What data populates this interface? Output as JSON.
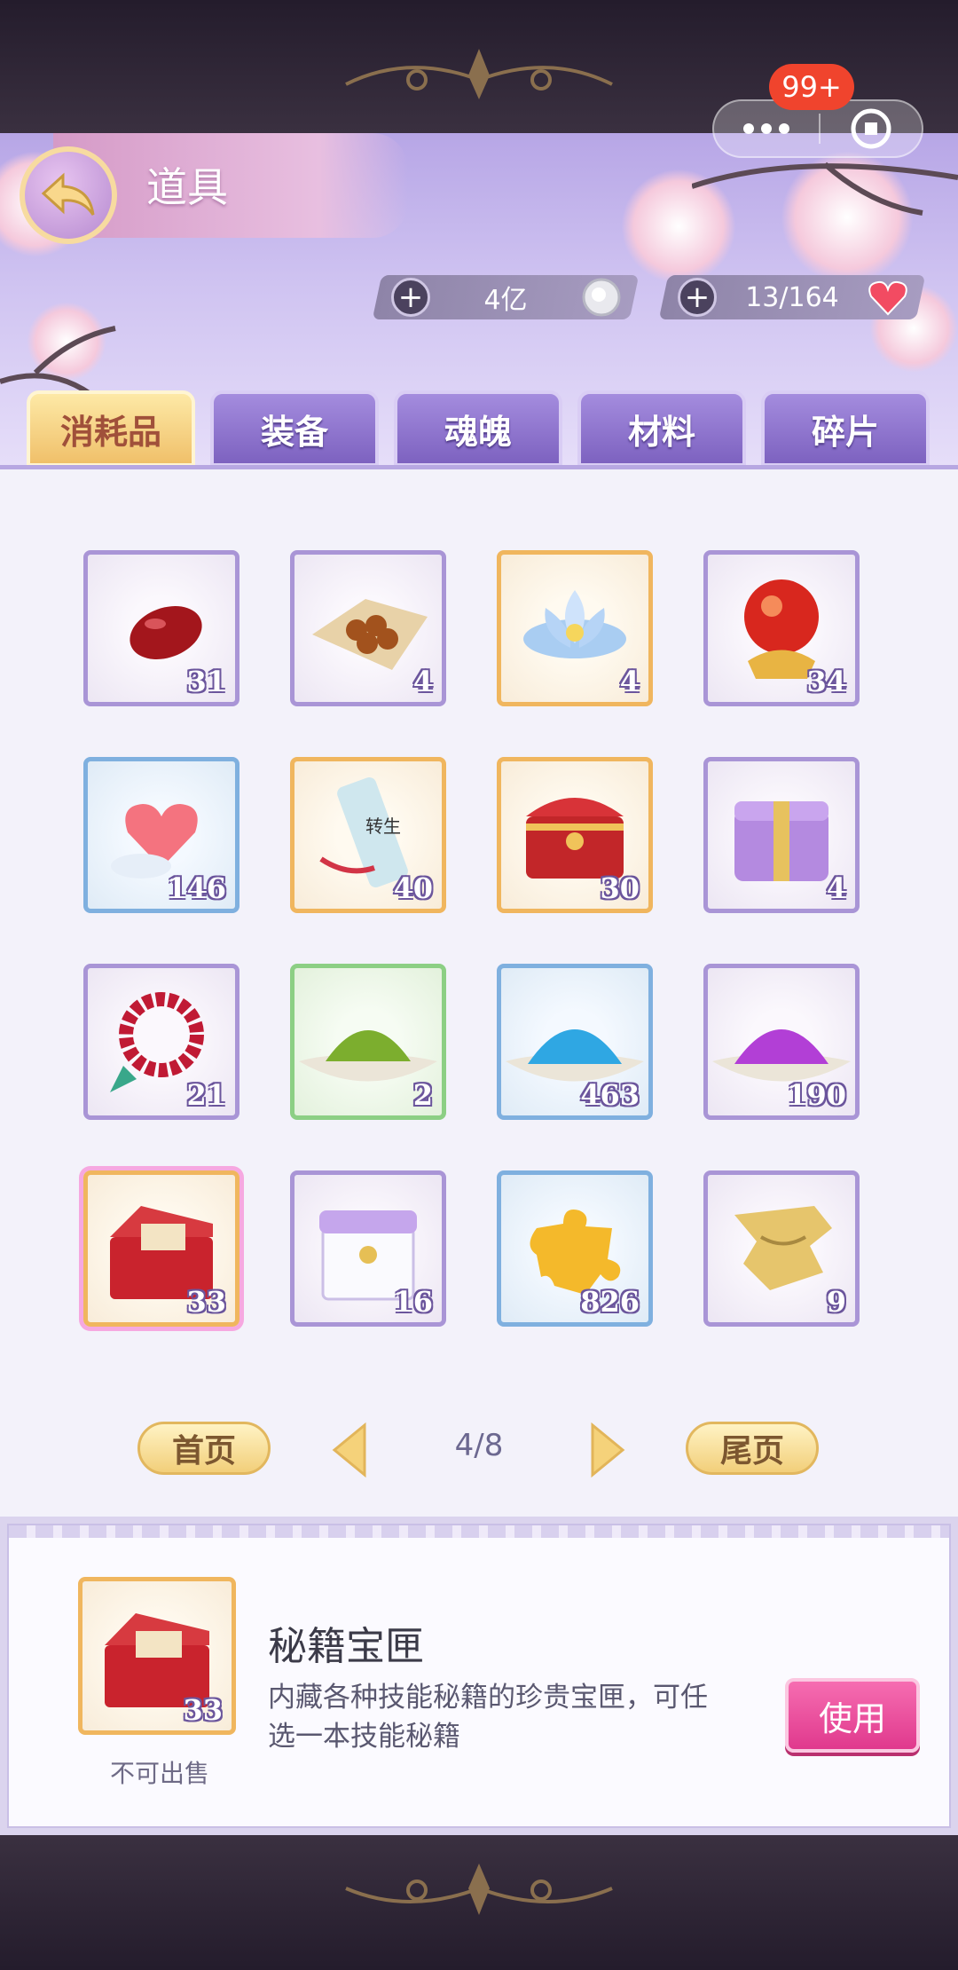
{
  "header": {
    "title": "道具",
    "currencies": [
      {
        "value": "4亿",
        "icon": "silver-coin-icon"
      },
      {
        "value": "13/164",
        "icon": "heart-icon"
      }
    ],
    "badge": "99+"
  },
  "tabs": [
    {
      "label": "消耗品",
      "active": true
    },
    {
      "label": "装备",
      "active": false
    },
    {
      "label": "魂魄",
      "active": false
    },
    {
      "label": "材料",
      "active": false
    },
    {
      "label": "碎片",
      "active": false
    }
  ],
  "items": [
    {
      "icon": "red-bean-icon",
      "count": "31",
      "rarity": "purple"
    },
    {
      "icon": "beads-on-cloth-icon",
      "count": "4",
      "rarity": "purple"
    },
    {
      "icon": "blue-lotus-icon",
      "count": "4",
      "rarity": "orange"
    },
    {
      "icon": "crystal-orb-icon",
      "count": "34",
      "rarity": "purple"
    },
    {
      "icon": "heart-cloud-icon",
      "count": "146",
      "rarity": "blue"
    },
    {
      "icon": "scroll-icon",
      "count": "40",
      "rarity": "orange",
      "scroll_text": "转生"
    },
    {
      "icon": "red-chest-icon",
      "count": "30",
      "rarity": "orange"
    },
    {
      "icon": "purple-box-icon",
      "count": "4",
      "rarity": "purple"
    },
    {
      "icon": "prayer-beads-icon",
      "count": "21",
      "rarity": "purple"
    },
    {
      "icon": "green-powder-icon",
      "count": "2",
      "rarity": "green"
    },
    {
      "icon": "blue-powder-icon",
      "count": "463",
      "rarity": "blue"
    },
    {
      "icon": "purple-powder-icon",
      "count": "190",
      "rarity": "purple"
    },
    {
      "icon": "secret-box-icon",
      "count": "33",
      "rarity": "orange",
      "selected": true
    },
    {
      "icon": "white-gift-box-icon",
      "count": "16",
      "rarity": "purple"
    },
    {
      "icon": "gold-puzzle-icon",
      "count": "826",
      "rarity": "blue"
    },
    {
      "icon": "map-fragment-icon",
      "count": "9",
      "rarity": "purple"
    }
  ],
  "pagination": {
    "first": "首页",
    "last": "尾页",
    "page": "4/8"
  },
  "detail": {
    "name": "秘籍宝匣",
    "description": "内藏各种技能秘籍的珍贵宝匣，可任选一本技能秘籍",
    "count": "33",
    "sell_status": "不可出售",
    "use_label": "使用",
    "icon": "secret-box-icon"
  }
}
